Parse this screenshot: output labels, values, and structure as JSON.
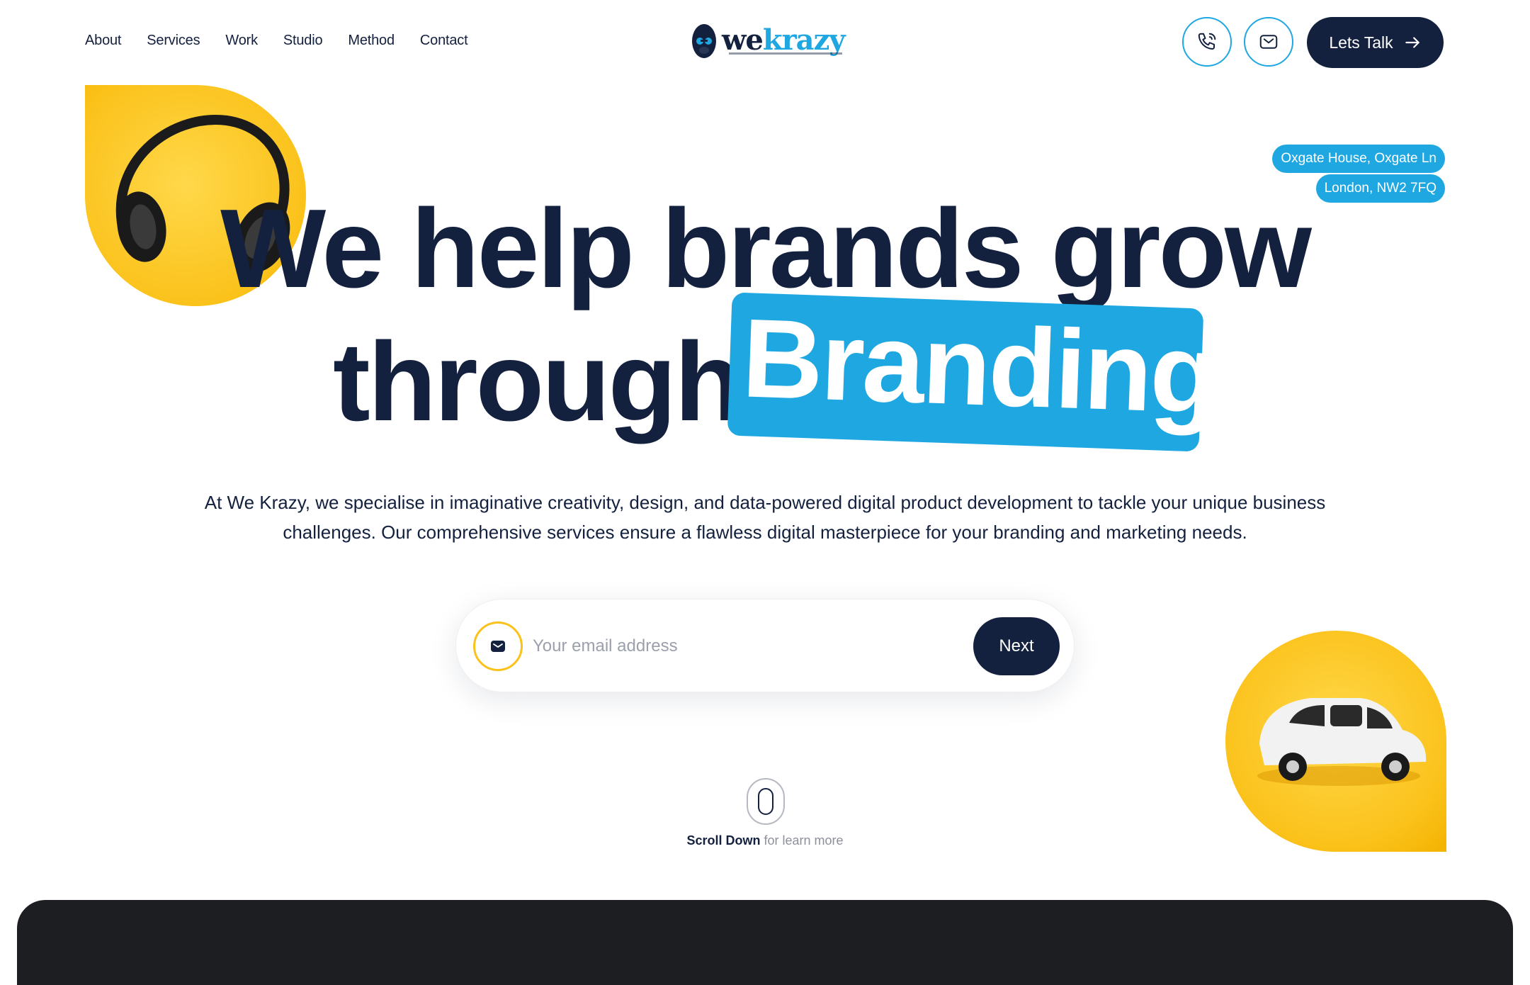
{
  "nav": {
    "items": [
      "About",
      "Services",
      "Work",
      "Studio",
      "Method",
      "Contact"
    ]
  },
  "logo": {
    "we": "we",
    "krazy": "krazy"
  },
  "header": {
    "cta_label": "Lets Talk"
  },
  "address": {
    "line1": "Oxgate House, Oxgate Ln",
    "line2": "London, NW2 7FQ"
  },
  "hero": {
    "line1": "We help brands grow",
    "line2_prefix": "through",
    "highlight": "Branding",
    "description": "At We Krazy, we specialise in imaginative creativity, design, and data-powered digital product development to tackle your unique business challenges. Our comprehensive services ensure a flawless digital masterpiece for your branding and marketing needs."
  },
  "form": {
    "placeholder": "Your email address",
    "button": "Next"
  },
  "scroll": {
    "strong": "Scroll Down",
    "rest": " for learn more"
  },
  "colors": {
    "navy": "#13213f",
    "accent": "#1fa7e1",
    "yellow": "#fbc21b",
    "dark": "#1c1e22"
  },
  "icons": [
    "phone-icon",
    "mail-icon",
    "arrow-right-icon",
    "envelope-icon",
    "mouse-icon"
  ]
}
